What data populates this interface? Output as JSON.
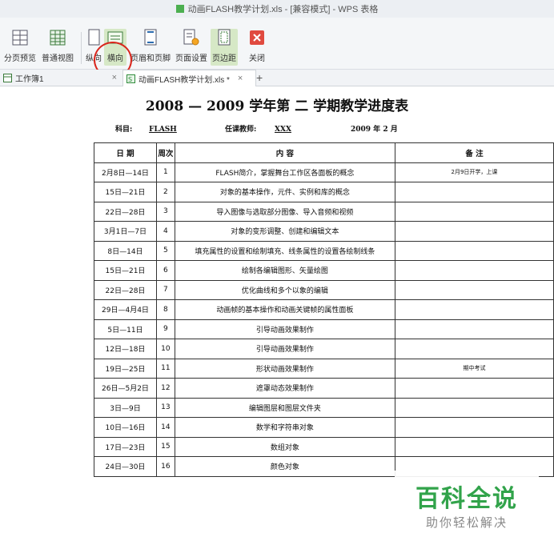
{
  "window": {
    "title": "动画FLASH教学计划.xls - [兼容模式] - WPS 表格"
  },
  "toolbar": {
    "page_break_preview": "分页预览",
    "normal_view": "普通视图",
    "portrait": "纵向",
    "landscape": "横向",
    "header_footer": "页眉和页脚",
    "page_setup": "页面设置",
    "margins": "页边距",
    "close": "关闭"
  },
  "tabs": [
    {
      "label": "工作簿1"
    },
    {
      "label": "动画FLASH教学计划.xls *"
    }
  ],
  "tab_controls": {
    "close": "×",
    "new_tab": "+"
  },
  "document": {
    "title": "2008 — 2009 学年第 二 学期教学进度表",
    "subject_label": "科目:",
    "subject_value": "FLASH",
    "teacher_label": "任课教师:",
    "teacher_value": "XXX",
    "date": "2009 年 2 月",
    "columns": [
      "日  期",
      "周次",
      "内          容",
      "备  注"
    ],
    "rows": [
      {
        "date": "2月8日—14日",
        "week": "1",
        "content": "FLASH简介，掌握舞台工作区各面板的概念",
        "note": "2月9日开学，上课"
      },
      {
        "date": "15日—21日",
        "week": "2",
        "content": "对象的基本操作，元件、实例和库的概念",
        "note": ""
      },
      {
        "date": "22日—28日",
        "week": "3",
        "content": "导入图像与选取部分图像、导入音频和视频",
        "note": ""
      },
      {
        "date": "3月1日—7日",
        "week": "4",
        "content": "对象的变形调整、创建和编辑文本",
        "note": ""
      },
      {
        "date": "8日—14日",
        "week": "5",
        "content": "填充属性的设置和绘制填充、线条属性的设置各绘制线条",
        "note": ""
      },
      {
        "date": "15日—21日",
        "week": "6",
        "content": "绘制各编辑图形、矢量绘图",
        "note": ""
      },
      {
        "date": "22日—28日",
        "week": "7",
        "content": "优化曲线和多个以象的编辑",
        "note": ""
      },
      {
        "date": "29日—4月4日",
        "week": "8",
        "content": "动画帧的基本操作和动画关键帧的属性面板",
        "note": ""
      },
      {
        "date": "5日—11日",
        "week": "9",
        "content": "引导动画效果制作",
        "note": ""
      },
      {
        "date": "12日—18日",
        "week": "10",
        "content": "引导动画效果制作",
        "note": ""
      },
      {
        "date": "19日—25日",
        "week": "11",
        "content": "形状动画效果制作",
        "note": "期中考试"
      },
      {
        "date": "26日—5月2日",
        "week": "12",
        "content": "遮罩动态效果制作",
        "note": ""
      },
      {
        "date": "3日—9日",
        "week": "13",
        "content": "编辑图层和图层文件夹",
        "note": ""
      },
      {
        "date": "10日—16日",
        "week": "14",
        "content": "数学和字符串对象",
        "note": ""
      },
      {
        "date": "17日—23日",
        "week": "15",
        "content": "数组对象",
        "note": ""
      },
      {
        "date": "24日—30日",
        "week": "16",
        "content": "颜色对象",
        "note": ""
      }
    ]
  },
  "watermark": {
    "main": "百科全说",
    "sub": "助你轻松解决"
  },
  "colors": {
    "highlight": "#d9261c",
    "watermark_green": "#31a34a",
    "active_button": "#d6e8c6"
  }
}
